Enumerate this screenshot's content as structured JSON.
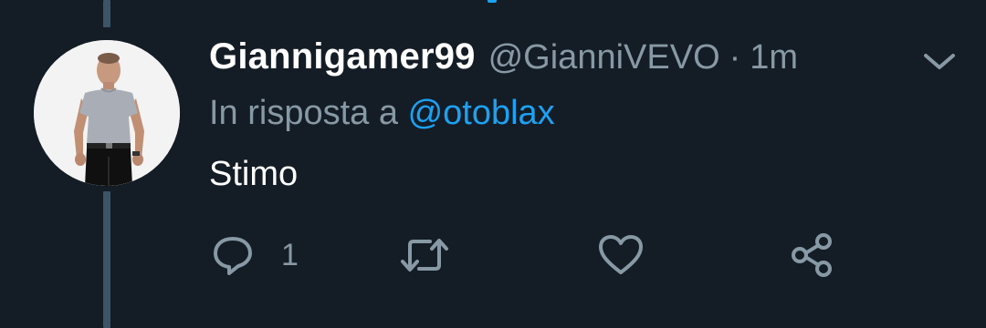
{
  "colors": {
    "background": "#141d26",
    "name": "#ffffff",
    "secondary": "#8899a6",
    "link": "#1da1f2",
    "thread_line": "#3d5466"
  },
  "tweet": {
    "display_name": "Giannigamer99",
    "handle": "@GianniVEVO",
    "separator": "·",
    "timestamp": "1m",
    "reply_prefix": "In risposta a",
    "reply_mention": "@otoblax",
    "text": "Stimo",
    "avatar_icon": "user-avatar-photo"
  },
  "actions": {
    "reply": {
      "icon": "reply-icon",
      "count": "1"
    },
    "retweet": {
      "icon": "retweet-icon"
    },
    "like": {
      "icon": "heart-icon"
    },
    "share": {
      "icon": "share-icon"
    }
  },
  "menu": {
    "icon": "chevron-down-icon"
  }
}
